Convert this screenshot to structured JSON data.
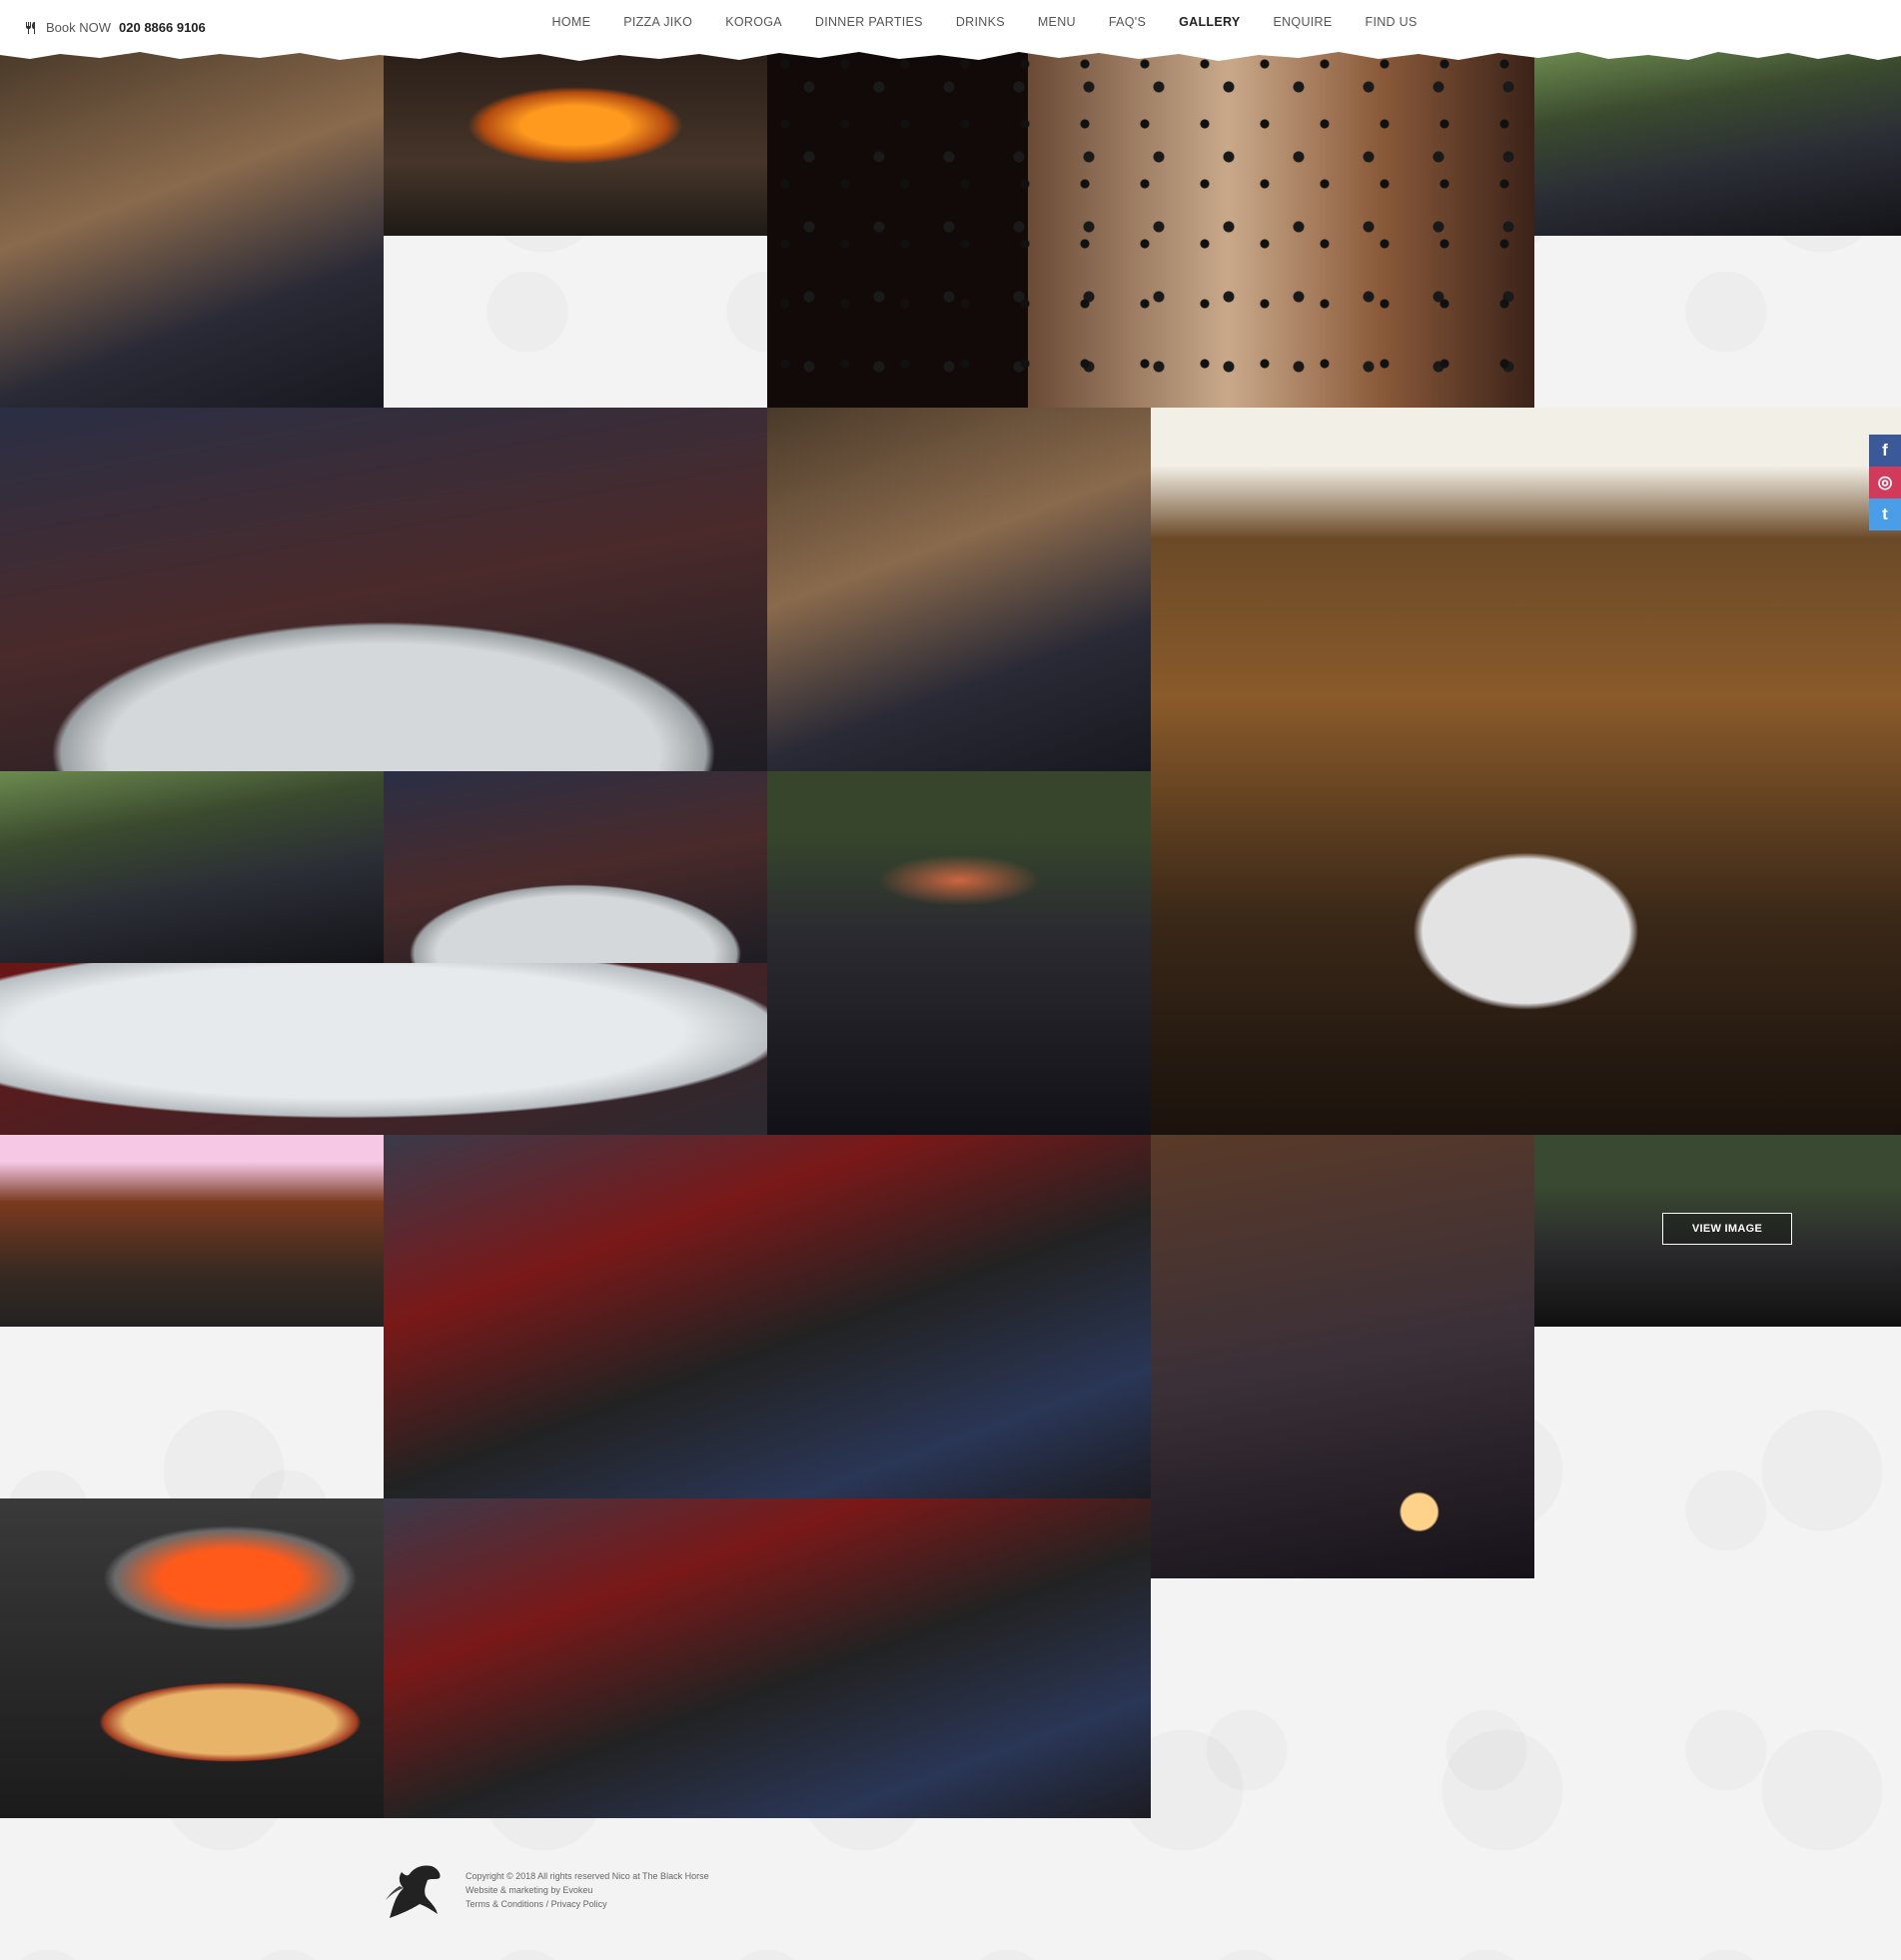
{
  "header": {
    "book_label": "Book NOW",
    "phone": "020 8866 9106",
    "cutlery_icon": "cutlery-icon"
  },
  "nav": [
    {
      "label": "HOME",
      "active": false
    },
    {
      "label": "PIZZA JIKO",
      "active": false
    },
    {
      "label": "KOROGA",
      "active": false
    },
    {
      "label": "DINNER PARTIES",
      "active": false
    },
    {
      "label": "DRINKS",
      "active": false
    },
    {
      "label": "MENU",
      "active": false
    },
    {
      "label": "FAQ'S",
      "active": false
    },
    {
      "label": "GALLERY",
      "active": true
    },
    {
      "label": "ENQUIRE",
      "active": false
    },
    {
      "label": "FIND US",
      "active": false
    }
  ],
  "gallery": {
    "view_button": "VIEW IMAGE"
  },
  "social": {
    "facebook": "f",
    "instagram": "◎",
    "twitter": "t"
  },
  "footer": {
    "copyright": "Copyright © 2018 All rights reserved Nico at The Black Horse",
    "credit": "Website & marketing by Evokeu",
    "terms": "Terms & Conditions",
    "separator": "/",
    "privacy": "Privacy Policy"
  }
}
